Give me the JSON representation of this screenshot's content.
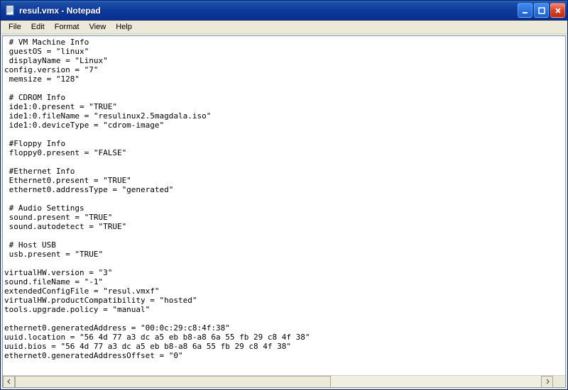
{
  "window": {
    "title": "resul.vmx - Notepad"
  },
  "menu": {
    "file": "File",
    "edit": "Edit",
    "format": "Format",
    "view": "View",
    "help": "Help"
  },
  "document": {
    "content": " # VM Machine Info\n guestOS = \"linux\"\n displayName = \"Linux\"\nconfig.version = \"7\"\n memsize = \"128\"\n\n # CDROM Info\n ide1:0.present = \"TRUE\"\n ide1:0.fileName = \"resulinux2.5magdala.iso\"\n ide1:0.deviceType = \"cdrom-image\"\n\n #Floppy Info\n floppy0.present = \"FALSE\"\n\n #Ethernet Info\n Ethernet0.present = \"TRUE\"\n ethernet0.addressType = \"generated\"\n\n # Audio Settings\n sound.present = \"TRUE\"\n sound.autodetect = \"TRUE\"\n\n # Host USB\n usb.present = \"TRUE\"\n\nvirtualHW.version = \"3\"\nsound.fileName = \"-1\"\nextendedConfigFile = \"resul.vmxf\"\nvirtualHW.productCompatibility = \"hosted\"\ntools.upgrade.policy = \"manual\"\n\nethernet0.generatedAddress = \"00:0c:29:c8:4f:38\"\nuuid.location = \"56 4d 77 a3 dc a5 eb b8-a8 6a 55 fb 29 c8 4f 38\"\nuuid.bios = \"56 4d 77 a3 dc a5 eb b8-a8 6a 55 fb 29 c8 4f 38\"\nethernet0.generatedAddressOffset = \"0\"\n"
  }
}
